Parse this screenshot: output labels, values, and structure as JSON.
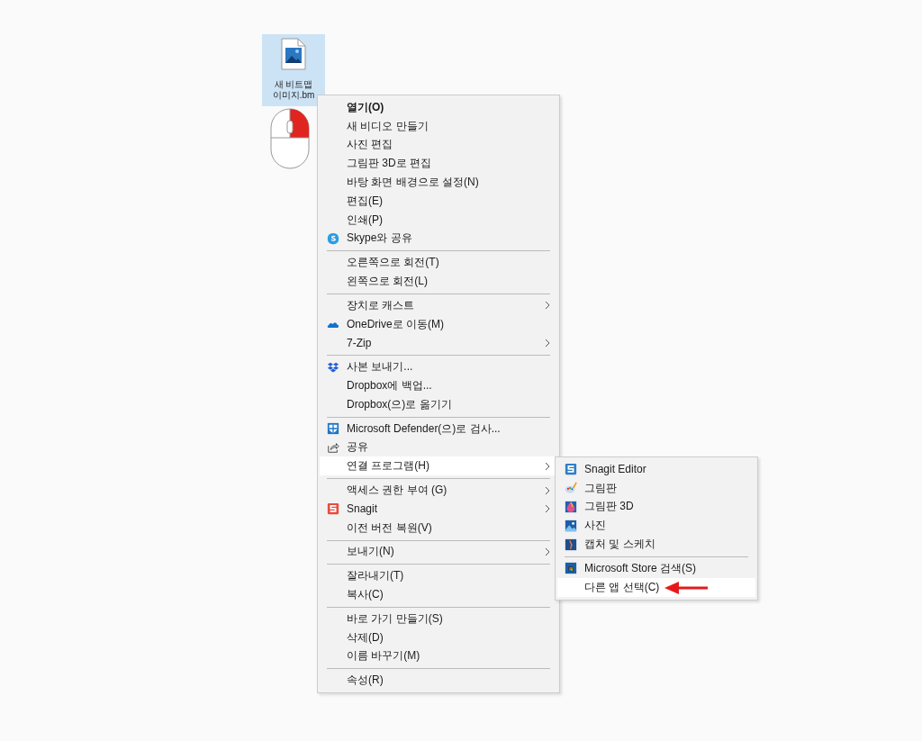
{
  "desktop_icon": {
    "label_lines": [
      "새 비트맵",
      "이미지.bm"
    ],
    "selected": true
  },
  "context_menu": {
    "items": [
      {
        "kind": "item",
        "label": "열기(O)",
        "bold": true,
        "selected": false
      },
      {
        "kind": "item",
        "label": "새 비디오 만들기",
        "selected": false
      },
      {
        "kind": "item",
        "label": "사진 편집",
        "selected": false
      },
      {
        "kind": "item",
        "label": "그림판 3D로 편집",
        "selected": false
      },
      {
        "kind": "item",
        "label": "바탕 화면 배경으로 설정(N)",
        "selected": false
      },
      {
        "kind": "item",
        "label": "편집(E)",
        "selected": false
      },
      {
        "kind": "item",
        "label": "인쇄(P)",
        "selected": false
      },
      {
        "kind": "item",
        "label": "Skype와 공유",
        "selected": false
      },
      {
        "kind": "separator"
      },
      {
        "kind": "item",
        "label": "오른쪽으로 회전(T)",
        "selected": false
      },
      {
        "kind": "item",
        "label": "왼쪽으로 회전(L)",
        "selected": false
      },
      {
        "kind": "separator"
      },
      {
        "kind": "item",
        "label": "장치로 캐스트",
        "submenu": true,
        "selected": false
      },
      {
        "kind": "item",
        "label": "OneDrive로 이동(M)",
        "selected": false
      },
      {
        "kind": "item",
        "label": "7-Zip",
        "submenu": true,
        "selected": false
      },
      {
        "kind": "separator"
      },
      {
        "kind": "item",
        "label": "사본 보내기...",
        "selected": false
      },
      {
        "kind": "item",
        "label": "Dropbox에 백업...",
        "selected": false
      },
      {
        "kind": "item",
        "label": "Dropbox(으)로 옮기기",
        "selected": false
      },
      {
        "kind": "separator"
      },
      {
        "kind": "item",
        "label": "Microsoft Defender(으)로 검사...",
        "selected": false
      },
      {
        "kind": "item",
        "label": "공유",
        "selected": false
      },
      {
        "kind": "item",
        "label": "연결 프로그램(H)",
        "submenu": true,
        "selected": true
      },
      {
        "kind": "separator"
      },
      {
        "kind": "item",
        "label": "액세스 권한 부여 (G)",
        "submenu": true,
        "selected": false
      },
      {
        "kind": "item",
        "label": "Snagit",
        "submenu": true,
        "selected": false
      },
      {
        "kind": "item",
        "label": "이전 버전 복원(V)",
        "selected": false
      },
      {
        "kind": "separator"
      },
      {
        "kind": "item",
        "label": "보내기(N)",
        "submenu": true,
        "selected": false
      },
      {
        "kind": "separator"
      },
      {
        "kind": "item",
        "label": "잘라내기(T)",
        "selected": false
      },
      {
        "kind": "item",
        "label": "복사(C)",
        "selected": false
      },
      {
        "kind": "separator"
      },
      {
        "kind": "item",
        "label": "바로 가기 만들기(S)",
        "selected": false
      },
      {
        "kind": "item",
        "label": "삭제(D)",
        "selected": false
      },
      {
        "kind": "item",
        "label": "이름 바꾸기(M)",
        "selected": false
      },
      {
        "kind": "separator"
      },
      {
        "kind": "item",
        "label": "속성(R)",
        "selected": false
      }
    ]
  },
  "submenu": {
    "items": [
      {
        "kind": "item",
        "label": "Snagit Editor",
        "selected": false
      },
      {
        "kind": "item",
        "label": "그림판",
        "selected": false
      },
      {
        "kind": "item",
        "label": "그림판 3D",
        "selected": false
      },
      {
        "kind": "item",
        "label": "사진",
        "selected": false
      },
      {
        "kind": "item",
        "label": "캡처 및 스케치",
        "selected": false
      },
      {
        "kind": "separator"
      },
      {
        "kind": "item",
        "label": "Microsoft Store 검색(S)",
        "selected": false
      },
      {
        "kind": "item",
        "label": "다른 앱 선택(C)",
        "selected": true
      }
    ]
  }
}
